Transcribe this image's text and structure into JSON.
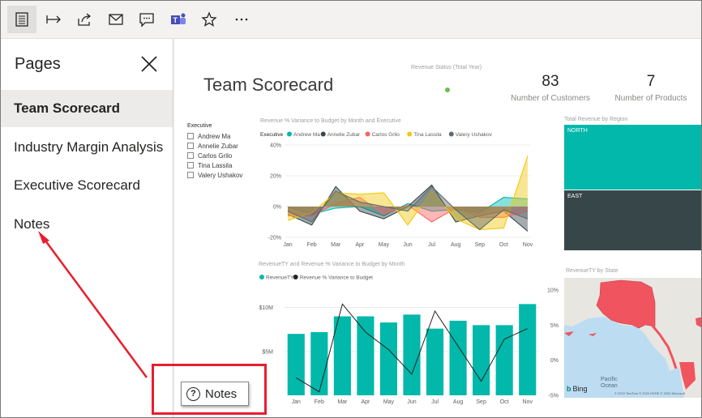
{
  "toolbar": {
    "icons": [
      "pages-list-icon",
      "expand-arrow-icon",
      "share-icon",
      "mail-icon",
      "comment-icon",
      "teams-icon",
      "star-icon",
      "more-icon"
    ]
  },
  "pane": {
    "title": "Pages",
    "items": [
      {
        "label": "Team Scorecard",
        "selected": true
      },
      {
        "label": "Industry Margin Analysis"
      },
      {
        "label": "Executive Scorecard"
      },
      {
        "label": "Notes"
      }
    ]
  },
  "report": {
    "title": "Team Scorecard",
    "revenue_status_label": "Revenue Status (Total Year)",
    "kpis": [
      {
        "value": "83",
        "label": "Number of Customers"
      },
      {
        "value": "7",
        "label": "Number of Products"
      }
    ],
    "slicer": {
      "header": "Executive",
      "options": [
        "Andrew Ma",
        "Annelie Zubar",
        "Carlos Grilo",
        "Tina Lassila",
        "Valery Ushakov"
      ]
    },
    "region_title": "Total Revenue by Region",
    "regions": [
      "NORTH",
      "EAST"
    ],
    "map_title": "RevenueTY by State",
    "map_labels": {
      "ocean": "Pacific\nOcean",
      "bing": "Bing",
      "copyright": "© 2020 TomTom © 2020 HERE © 2020 Microsoft"
    }
  },
  "chart_data": [
    {
      "type": "area",
      "title": "Revenue % Variance to Budget by Month and Executive",
      "legend_title": "Executive",
      "categories": [
        "Jan",
        "Feb",
        "Mar",
        "Apr",
        "May",
        "Jun",
        "Jul",
        "Aug",
        "Sep",
        "Oct",
        "Nov"
      ],
      "yticks": [
        "40%",
        "20%",
        "0%",
        "-20%"
      ],
      "ylim": [
        -20,
        40
      ],
      "series": [
        {
          "name": "Andrew Ma",
          "color": "#01b8aa",
          "values": [
            0,
            -5,
            -1,
            0,
            -6,
            2,
            -3,
            -2,
            -4,
            6,
            5
          ]
        },
        {
          "name": "Annelie Zubar",
          "color": "#374649",
          "values": [
            -5,
            -12,
            13,
            -3,
            -8,
            0,
            14,
            -10,
            -6,
            -3,
            -16
          ]
        },
        {
          "name": "Carlos Grilo",
          "color": "#fd625e",
          "values": [
            -6,
            -6,
            2,
            6,
            -5,
            1,
            -10,
            -1,
            -7,
            -7,
            -3
          ]
        },
        {
          "name": "Tina Lassila",
          "color": "#f2c80f",
          "values": [
            -9,
            -4,
            9,
            8,
            9,
            -12,
            10,
            -8,
            -15,
            -14,
            33
          ]
        },
        {
          "name": "Valery Ushakov",
          "color": "#5f6b6d",
          "values": [
            -3,
            -10,
            10,
            3,
            0,
            -3,
            13,
            -2,
            -15,
            -2,
            -8
          ]
        }
      ]
    },
    {
      "type": "bar",
      "title": "RevenueTY and Revenue % Variance to Budget by Month",
      "categories": [
        "Jan",
        "Feb",
        "Mar",
        "Apr",
        "May",
        "Jun",
        "Jul",
        "Aug",
        "Sep",
        "Oct",
        "Nov"
      ],
      "yticks_left": [
        "$10M",
        "$5M"
      ],
      "yticks_right": [
        "10%",
        "5%",
        "0%",
        "-5%"
      ],
      "series": [
        {
          "name": "RevenueTY",
          "color": "#01b8aa",
          "values": [
            7.0,
            7.2,
            9.0,
            9.0,
            8.3,
            9.2,
            7.6,
            8.5,
            8.0,
            8.0,
            10.4
          ]
        },
        {
          "name": "Revenue % Variance to Budget",
          "color": "#252423",
          "values": [
            -2.5,
            -4.5,
            8,
            4,
            1.5,
            -2,
            7,
            2,
            -3,
            3,
            4.5
          ]
        }
      ],
      "ylim_left": [
        0,
        12
      ],
      "ylim_right": [
        -5,
        10
      ]
    }
  ]
}
